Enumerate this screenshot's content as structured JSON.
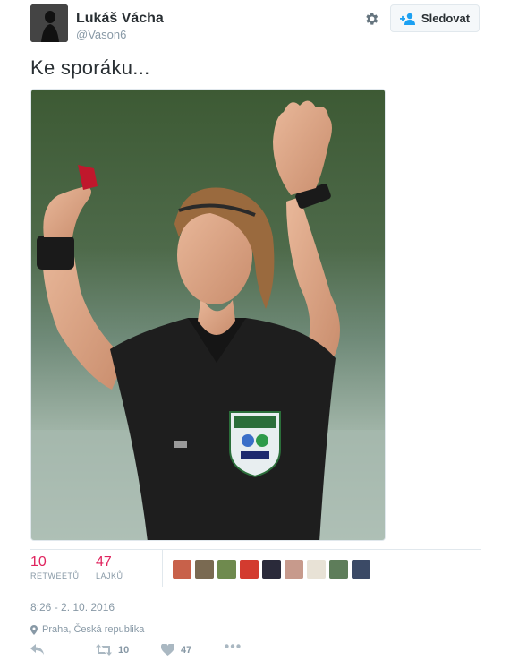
{
  "user": {
    "name": "Lukáš Vácha",
    "handle": "@Vason6"
  },
  "follow_button": {
    "label": "Sledovat"
  },
  "tweet": {
    "text": "Ke sporáku...",
    "timestamp": "8:26 - 2. 10. 2016",
    "location": "Praha, Česká republika"
  },
  "stats": {
    "retweets": {
      "count": "10",
      "label": "RETWEETŮ"
    },
    "likes": {
      "count": "47",
      "label": "LAJKŮ"
    }
  },
  "actions": {
    "retweet_count": "10",
    "like_count": "47"
  },
  "colors": {
    "accent": "#e0245e",
    "muted": "#8899a6",
    "border": "#e1e8ed",
    "link": "#1da1f2"
  },
  "icons": [
    "gear-icon",
    "add-user-icon",
    "location-pin-icon",
    "reply-icon",
    "retweet-icon",
    "heart-icon",
    "more-icon"
  ]
}
